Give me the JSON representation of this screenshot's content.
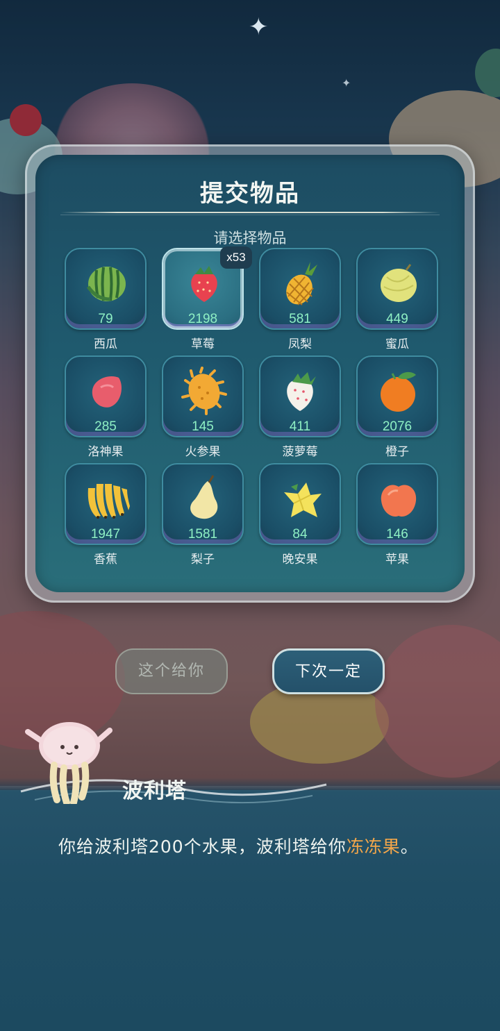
{
  "dialog": {
    "title": "提交物品",
    "subtitle": "请选择物品"
  },
  "selected_badge": "x53",
  "items": [
    {
      "name": "西瓜",
      "count": "79",
      "icon": "watermelon-icon",
      "color": "#7bb54e"
    },
    {
      "name": "草莓",
      "count": "2198",
      "icon": "strawberry-icon",
      "color": "#e8424f",
      "selected": true
    },
    {
      "name": "凤梨",
      "count": "581",
      "icon": "pineapple-icon",
      "color": "#f0b432"
    },
    {
      "name": "蜜瓜",
      "count": "449",
      "icon": "honeydew-icon",
      "color": "#e1e27c"
    },
    {
      "name": "洛神果",
      "count": "285",
      "icon": "roselle-icon",
      "color": "#e85d6c"
    },
    {
      "name": "火参果",
      "count": "145",
      "icon": "horned-melon-icon",
      "color": "#f2a934"
    },
    {
      "name": "菠萝莓",
      "count": "411",
      "icon": "pineberry-icon",
      "color": "#f5f1ea"
    },
    {
      "name": "橙子",
      "count": "2076",
      "icon": "orange-icon",
      "color": "#f07d22"
    },
    {
      "name": "香蕉",
      "count": "1947",
      "icon": "banana-icon",
      "color": "#f2c23a"
    },
    {
      "name": "梨子",
      "count": "1581",
      "icon": "pear-icon",
      "color": "#f2e6a6"
    },
    {
      "name": "晚安果",
      "count": "84",
      "icon": "star-fruit-icon",
      "color": "#f4e25c"
    },
    {
      "name": "苹果",
      "count": "146",
      "icon": "apple-icon",
      "color": "#f2764f"
    }
  ],
  "buttons": {
    "give": "这个给你",
    "next_time": "下次一定"
  },
  "speaker": {
    "name": "波利塔",
    "avatar_icon": "jellyfish-icon"
  },
  "dialogue": {
    "text_before": "你给波利塔200个水果，波利塔给你",
    "highlight": "冻冻果",
    "text_after": "。"
  },
  "colors": {
    "count_text": "#8ff0c4",
    "highlight": "#f2a64a",
    "panel": "#1f5a6e"
  }
}
